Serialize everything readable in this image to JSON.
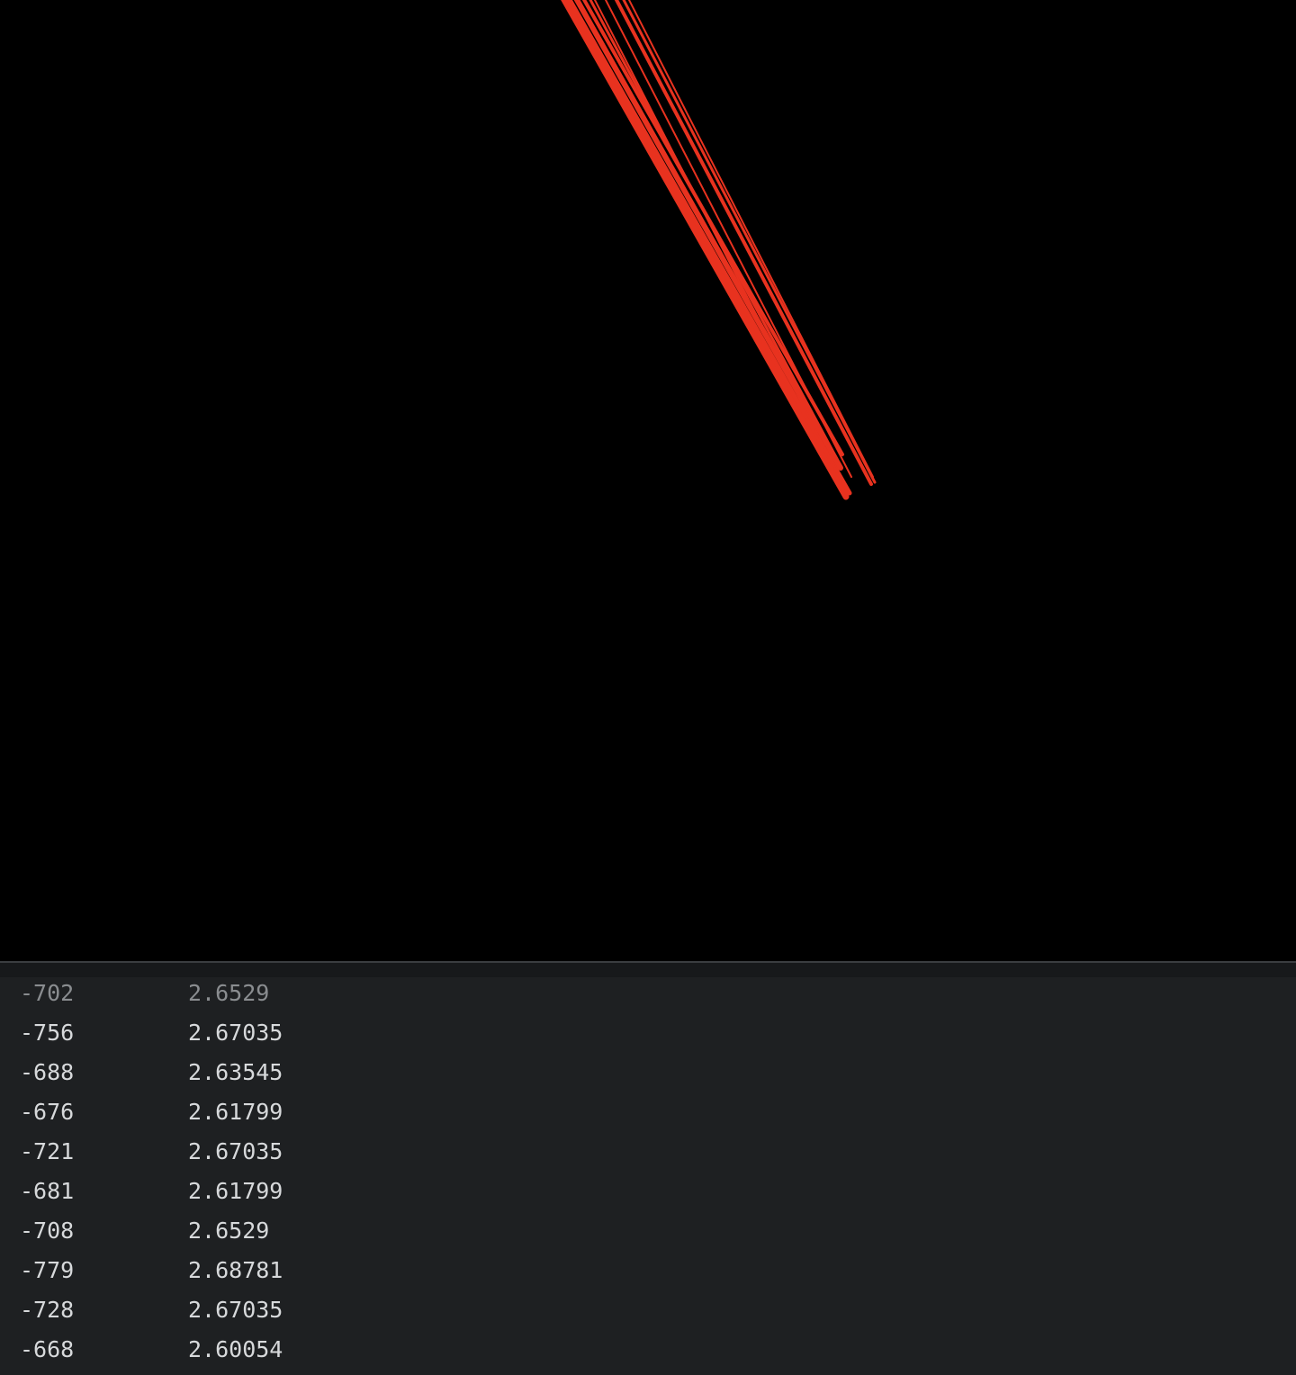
{
  "sketch": {
    "background_color": "#000000",
    "stroke_color": "#e8321f",
    "line_count": 10
  },
  "console": {
    "background_color": "#1e2022",
    "text_color": "#d7d9db",
    "rows": [
      {
        "a": "-702",
        "b": "2.6529"
      },
      {
        "a": "-756",
        "b": "2.67035"
      },
      {
        "a": "-688",
        "b": "2.63545"
      },
      {
        "a": "-676",
        "b": "2.61799"
      },
      {
        "a": "-721",
        "b": "2.67035"
      },
      {
        "a": "-681",
        "b": "2.61799"
      },
      {
        "a": "-708",
        "b": "2.6529"
      },
      {
        "a": "-779",
        "b": "2.68781"
      },
      {
        "a": "-728",
        "b": "2.67035"
      },
      {
        "a": "-668",
        "b": "2.60054"
      }
    ]
  }
}
